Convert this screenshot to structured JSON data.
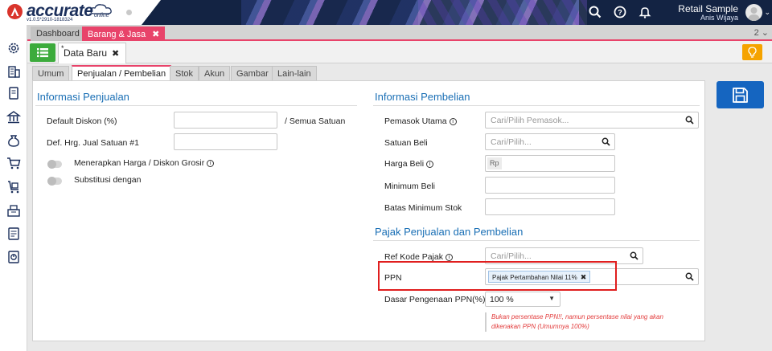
{
  "app": {
    "logo_text": "accurate",
    "logo_sub": "online",
    "version": "v1.0.5*2910-1818324",
    "user_name": "Retail Sample",
    "user_role": "Anis Wijaya"
  },
  "module_tabs": {
    "dashboard": "Dashboard",
    "barang": "Barang & Jasa",
    "close": "✖",
    "count": "2 ⌄"
  },
  "doc_tab": {
    "star": "*",
    "label": "Data Baru",
    "close": "✖"
  },
  "form_tabs": [
    "Umum",
    "Penjualan / Pembelian",
    "Stok",
    "Akun",
    "Gambar",
    "Lain-lain"
  ],
  "penjualan": {
    "title": "Informasi Penjualan",
    "default_diskon_label": "Default Diskon (%)",
    "semua_satuan": "/ Semua Satuan",
    "def_harga_label": "Def. Hrg. Jual Satuan #1",
    "grosir_label": "Menerapkan Harga / Diskon Grosir",
    "substitusi_label": "Substitusi dengan"
  },
  "pembelian": {
    "title": "Informasi Pembelian",
    "pemasok_label": "Pemasok Utama",
    "pemasok_placeholder": "Cari/Pilih Pemasok...",
    "satuan_label": "Satuan Beli",
    "satuan_placeholder": "Cari/Pilih...",
    "harga_label": "Harga Beli",
    "harga_prefix": "Rp",
    "minimum_label": "Minimum Beli",
    "batas_label": "Batas Minimum Stok"
  },
  "pajak": {
    "title": "Pajak Penjualan dan Pembelian",
    "ref_label": "Ref Kode Pajak",
    "ref_placeholder": "Cari/Pilih...",
    "ppn_label": "PPN",
    "ppn_chip": "Pajak Pertambahan Nilai 11%",
    "chip_close": "✖",
    "dasar_label": "Dasar Pengenaan PPN(%)",
    "dasar_value": "100 %",
    "warning_line1": "Bukan persentase PPN!!, namun persentase nilai yang akan",
    "warning_line2": "dikenakan PPN (Umumnya 100%)"
  },
  "colors": {
    "topbar": "#132343",
    "accent_pink": "#e8436a",
    "primary_blue": "#1565c0",
    "title_blue": "#1a6fb5",
    "list_green": "#3cab3c",
    "bulb_orange": "#f5a300",
    "highlight_red": "#e01e1e"
  },
  "icons": {
    "topbar": [
      "search-icon",
      "help-icon",
      "bell-icon"
    ],
    "sidebar": [
      "gear-icon",
      "building-icon",
      "book-icon",
      "bank-icon",
      "money-bag-icon",
      "cart-icon",
      "truck-cart-icon",
      "warehouse-icon",
      "ledger-icon",
      "report-icon"
    ]
  }
}
